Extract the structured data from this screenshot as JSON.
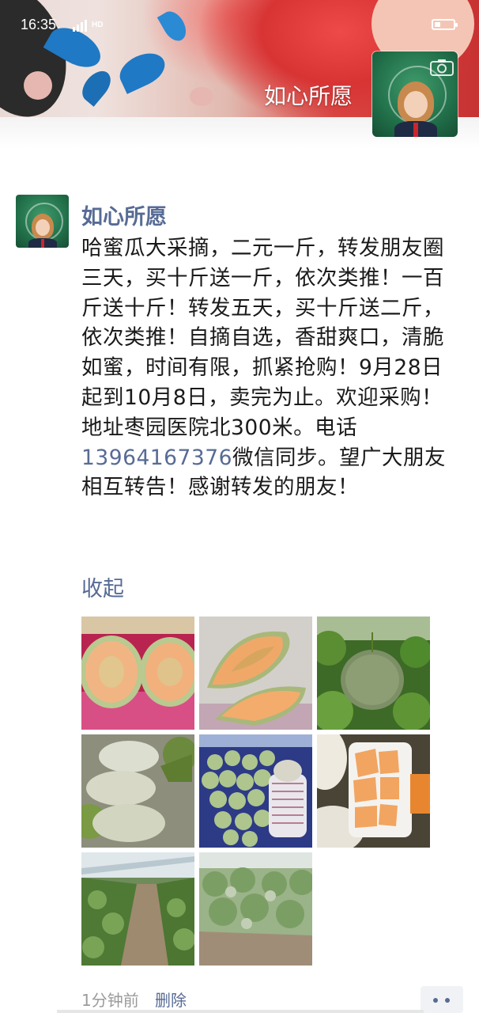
{
  "status_bar": {
    "time": "16:35",
    "network": "HD"
  },
  "profile": {
    "name": "如心所愿"
  },
  "post": {
    "author": "如心所愿",
    "text_before_phone": "哈蜜瓜大采摘，二元一斤，转发朋友圈三天，买十斤送一斤，依次类推！一百斤送十斤！转发五天，买十斤送二斤，依次类推！自摘自选，香甜爽口，清脆如蜜，时间有限，抓紧抢购！9月28日起到10月8日，卖完为止。欢迎采购！地址枣园医院北300米。电话",
    "phone": "13964167376",
    "text_after_phone": "微信同步。望广大朋友相互转告！感谢转发的朋友！",
    "collapse_label": "收起",
    "timestamp": "1分钟前",
    "delete_label": "删除",
    "photo_count": 8
  },
  "colors": {
    "link": "#576b95",
    "text": "#1a1a1a",
    "meta": "#9b9b9b"
  },
  "icons": [
    "camera-icon",
    "signal-icon",
    "battery-icon",
    "more-icon"
  ]
}
